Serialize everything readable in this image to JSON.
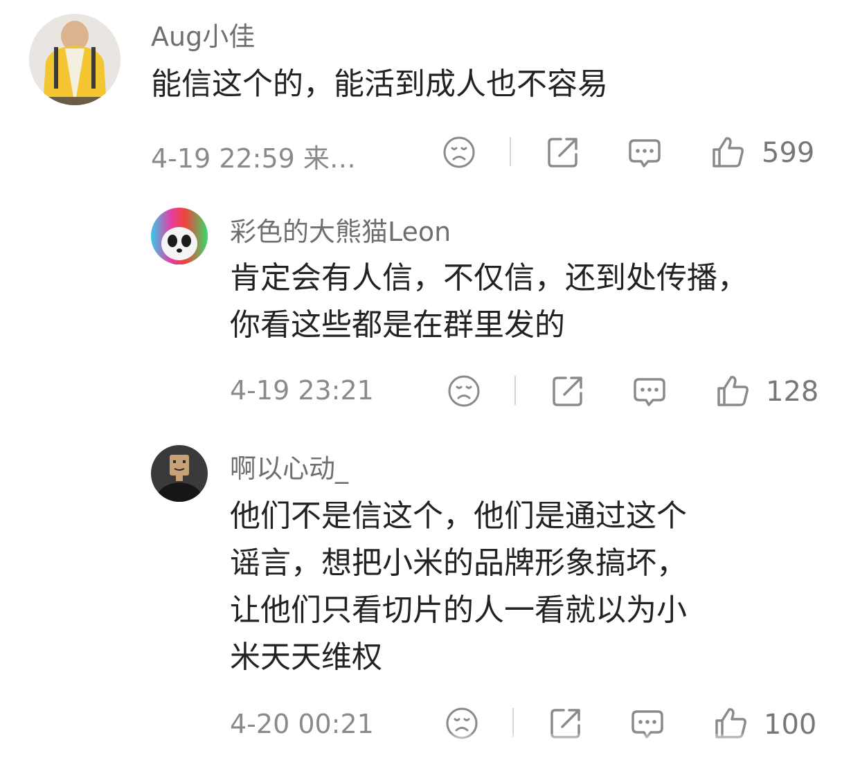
{
  "comments": [
    {
      "user": "Aug小佳",
      "text": "能信这个的，能活到成人也不容易",
      "meta": "4-19 22:59  来…",
      "likes": "599",
      "avatar_icon": "person-yellow-jacket-avatar"
    },
    {
      "user": "彩色的大熊猫Leon",
      "text": "肯定会有人信，不仅信，还到处传播，\n你看这些都是在群里发的",
      "meta": "4-19 23:21",
      "likes": "128",
      "avatar_icon": "rainbow-panda-avatar"
    },
    {
      "user": "啊以心动_",
      "text": "他们不是信这个，他们是通过这个\n谣言，想把小米的品牌形象搞坏，\n让他们只看切片的人一看就以为小\n米天天维权",
      "meta": "4-20 00:21",
      "likes": "100",
      "avatar_icon": "box-head-person-avatar"
    }
  ],
  "icons": {
    "dislike": "sad-face-icon",
    "share": "share-icon",
    "reply": "comment-bubble-icon",
    "like": "thumbs-up-icon"
  },
  "colors": {
    "username": "#6f6f6f",
    "text": "#222222",
    "meta": "#8a8a8a",
    "icon": "#8a8a8a"
  }
}
